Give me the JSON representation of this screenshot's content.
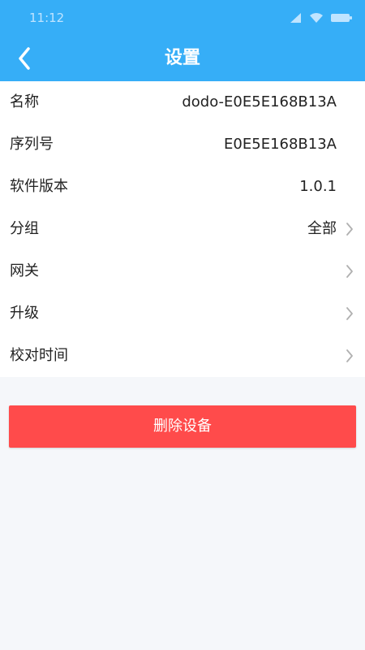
{
  "status_bar": {
    "time": "11:12",
    "icons": [
      "signal-icon",
      "wifi-icon",
      "battery-icon"
    ]
  },
  "header": {
    "back_icon": "chevron-left-icon",
    "title": "设置"
  },
  "settings": [
    {
      "label": "名称",
      "value": "dodo-E0E5E168B13A",
      "chevron": false
    },
    {
      "label": "序列号",
      "value": "E0E5E168B13A",
      "chevron": false
    },
    {
      "label": "软件版本",
      "value": "1.0.1",
      "chevron": false
    },
    {
      "label": "分组",
      "value": "全部",
      "chevron": true
    },
    {
      "label": "网关",
      "value": "",
      "chevron": true
    },
    {
      "label": "升级",
      "value": "",
      "chevron": true
    },
    {
      "label": "校对时间",
      "value": "",
      "chevron": true
    }
  ],
  "actions": {
    "delete_label": "删除设备"
  },
  "colors": {
    "primary": "#36aef7",
    "danger": "#ff4b4b",
    "background": "#f5f7fa",
    "chevron": "#b0b0b0"
  }
}
